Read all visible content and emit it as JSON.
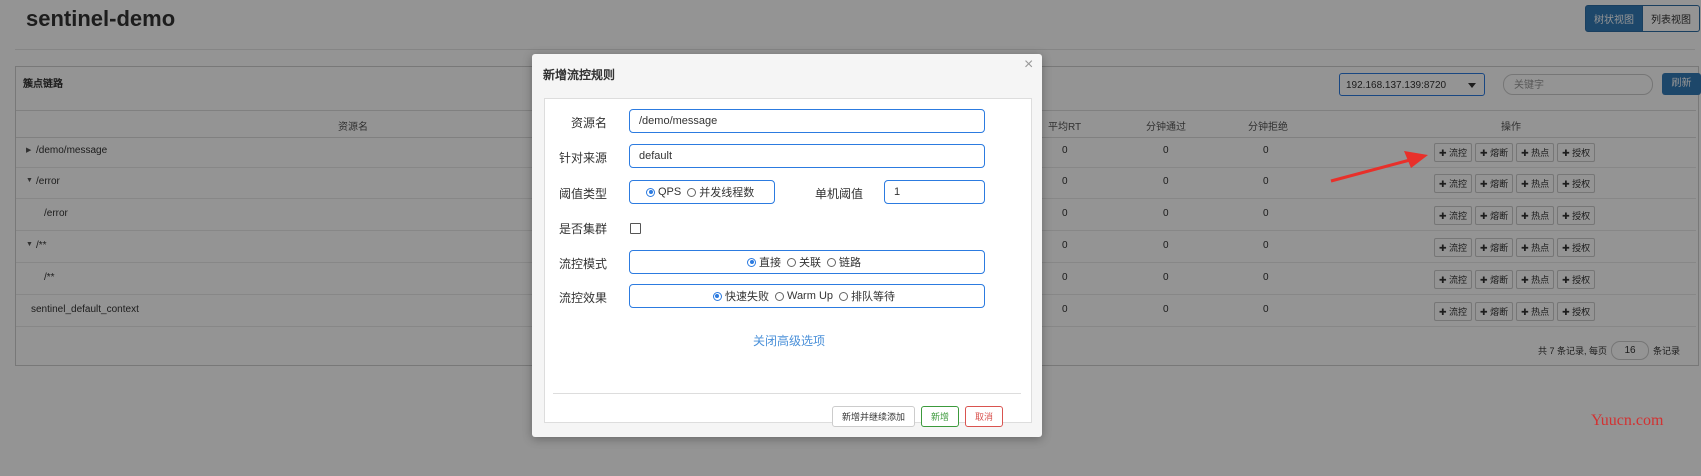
{
  "app": {
    "title": "sentinel-demo"
  },
  "view_toggle": {
    "tree": "树状视图",
    "list": "列表视图"
  },
  "panel": {
    "title": "簇点链路",
    "machine": "192.168.137.139:8720",
    "keyword_placeholder": "关键字",
    "refresh": "刷新"
  },
  "table": {
    "headers": {
      "resource": "资源名",
      "avg_rt": "平均RT",
      "pass_min": "分钟通过",
      "block_min": "分钟拒绝",
      "ops": "操作"
    },
    "rows": [
      {
        "prefix": "▶",
        "name": "/demo/message",
        "avg_rt": "0",
        "pass": "0",
        "block": "0"
      },
      {
        "prefix": "▼",
        "name": "/error",
        "avg_rt": "0",
        "pass": "0",
        "block": "0"
      },
      {
        "prefix": "",
        "name": "/error",
        "avg_rt": "0",
        "pass": "0",
        "block": "0"
      },
      {
        "prefix": "▼",
        "name": "/**",
        "avg_rt": "0",
        "pass": "0",
        "block": "0"
      },
      {
        "prefix": "",
        "name": "/**",
        "avg_rt": "0",
        "pass": "0",
        "block": "0"
      },
      {
        "prefix": "",
        "name": "sentinel_default_context",
        "avg_rt": "0",
        "pass": "0",
        "block": "0"
      }
    ],
    "op_buttons": [
      "✚ 流控",
      "✚ 熔断",
      "✚ 热点",
      "✚ 授权"
    ]
  },
  "pager": {
    "total_text": "共 7 条记录, 每页",
    "page_size": "16",
    "unit": "条记录"
  },
  "modal": {
    "title": "新增流控规则",
    "close": "×",
    "resource_label": "资源名",
    "resource_value": "/demo/message",
    "source_label": "针对来源",
    "source_value": "default",
    "threshold_type_label": "阈值类型",
    "threshold_type_options": [
      "QPS",
      "并发线程数"
    ],
    "threshold_type_selected": "QPS",
    "single_threshold_label": "单机阈值",
    "single_threshold_value": "1",
    "cluster_label": "是否集群",
    "cluster_checked": false,
    "mode_label": "流控模式",
    "mode_options": [
      "直接",
      "关联",
      "链路"
    ],
    "mode_selected": "直接",
    "effect_label": "流控效果",
    "effect_options": [
      "快速失败",
      "Warm Up",
      "排队等待"
    ],
    "effect_selected": "快速失败",
    "advanced_link": "关闭高级选项",
    "btn_add_continue": "新增并继续添加",
    "btn_add": "新增",
    "btn_cancel": "取消"
  },
  "watermark": "Yuucn.com",
  "colors": {
    "primary": "#337ab7",
    "input_border": "#2c7be0",
    "success": "#3c9a3c",
    "danger": "#d9534f",
    "arrow": "#e8302a"
  }
}
